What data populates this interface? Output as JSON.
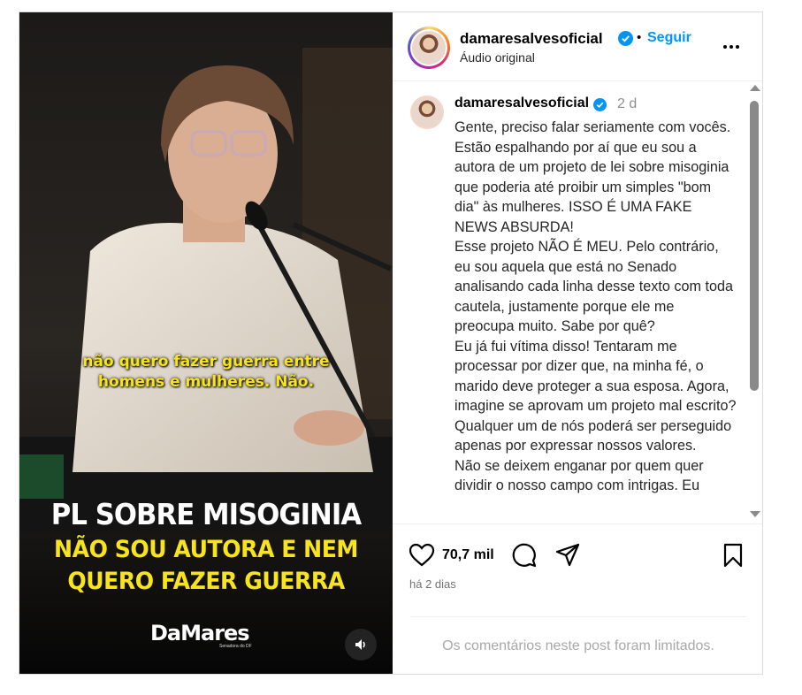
{
  "media": {
    "caption_line1": "não quero fazer guerra entre",
    "caption_line2": "homens e mulheres. Não.",
    "headline": "PL SOBRE MISOGINIA",
    "subheadline_line1": "NÃO SOU AUTORA E NEM",
    "subheadline_line2": "QUERO FAZER GUERRA",
    "brand": "DaMares",
    "brand_sub": "Senadora do DF",
    "audio_icon": "speaker-icon"
  },
  "header": {
    "username": "damaresalvesoficial",
    "dot": "•",
    "follow_label": "Seguir",
    "subtitle": "Áudio original",
    "more_icon": "more-icon"
  },
  "caption": {
    "username": "damaresalvesoficial",
    "time": "2 d",
    "text": "Gente, preciso falar seriamente com vocês. Estão espalhando por aí que eu sou a autora de um projeto de lei sobre misoginia que poderia até proibir um simples \"bom dia\" às mulheres. ISSO É UMA FAKE NEWS ABSURDA!\nEsse projeto NÃO É MEU. Pelo contrário, eu sou aquela que está no Senado analisando cada linha desse texto com toda cautela, justamente porque ele me preocupa muito. Sabe por quê?\nEu já fui vítima disso! Tentaram me processar por dizer que, na minha fé, o marido deve proteger a sua esposa. Agora, imagine se aprovam um projeto mal escrito? Qualquer um de nós poderá ser perseguido apenas por expressar nossos valores.\nNão se deixem enganar por quem quer dividir o nosso campo com intrigas. Eu"
  },
  "actions": {
    "likes": "70,7 mil",
    "ago": "há 2 dias",
    "comments_limited": "Os comentários neste post foram limitados."
  },
  "colors": {
    "accent": "#0095f6",
    "headline_yellow": "#f7e51a",
    "muted": "#737373"
  }
}
